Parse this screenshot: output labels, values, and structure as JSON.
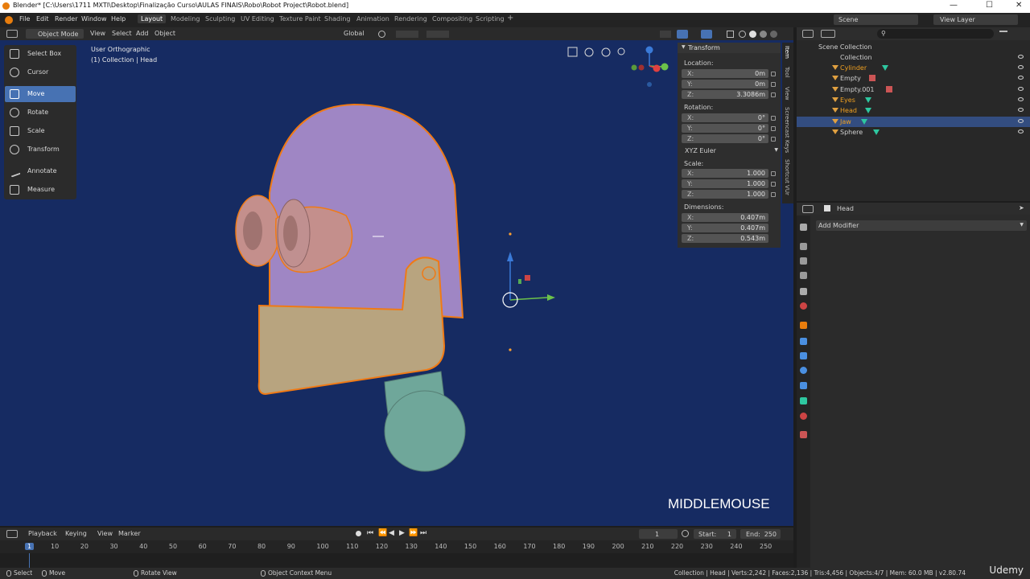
{
  "window": {
    "title": "Blender* [C:\\Users\\1711 MXTI\\Desktop\\Finalização Curso\\AULAS FINAIS\\Robo\\Robot Project\\Robot.blend]",
    "minimize": "—",
    "maximize": "☐",
    "close": "✕"
  },
  "menu": [
    "File",
    "Edit",
    "Render",
    "Window",
    "Help"
  ],
  "workspaces": [
    "Layout",
    "Modeling",
    "Sculpting",
    "UV Editing",
    "Texture Paint",
    "Shading",
    "Animation",
    "Rendering",
    "Compositing",
    "Scripting"
  ],
  "workspace_add": "+",
  "scene": {
    "label": "Scene",
    "view_layer": "View Layer"
  },
  "viewport_header": {
    "mode": "Object Mode",
    "menus": [
      "View",
      "Select",
      "Add",
      "Object"
    ],
    "orientation": "Global"
  },
  "viewport": {
    "view_name": "User Orthographic",
    "collection_info": "(1) Collection | Head",
    "key_overlay": "MIDDLEMOUSE",
    "colors": {
      "background": "#162b62",
      "head": "#9f86c4",
      "eyes": "#c48f8c",
      "jaw": "#b8a47f",
      "neck": "#6fa79a",
      "selection": "#f07a15"
    }
  },
  "tools": [
    "Select Box",
    "Cursor",
    "Move",
    "Rotate",
    "Scale",
    "Transform",
    "Annotate",
    "Measure"
  ],
  "active_tool": "Move",
  "npanel": {
    "tabs": [
      "Item",
      "Tool",
      "View",
      "Screencast Keys",
      "Shortcut VUr"
    ],
    "header": "Transform",
    "location_label": "Location:",
    "location": [
      {
        "k": "X:",
        "v": "0m"
      },
      {
        "k": "Y:",
        "v": "0m"
      },
      {
        "k": "Z:",
        "v": "3.3086m"
      }
    ],
    "rotation_label": "Rotation:",
    "rotation": [
      {
        "k": "X:",
        "v": "0°"
      },
      {
        "k": "Y:",
        "v": "0°"
      },
      {
        "k": "Z:",
        "v": "0°"
      }
    ],
    "rotation_mode": "XYZ Euler",
    "scale_label": "Scale:",
    "scale": [
      {
        "k": "X:",
        "v": "1.000"
      },
      {
        "k": "Y:",
        "v": "1.000"
      },
      {
        "k": "Z:",
        "v": "1.000"
      }
    ],
    "dimensions_label": "Dimensions:",
    "dimensions": [
      {
        "k": "X:",
        "v": "0.407m"
      },
      {
        "k": "Y:",
        "v": "0.407m"
      },
      {
        "k": "Z:",
        "v": "0.543m"
      }
    ]
  },
  "outliner": {
    "scene_collection": "Scene Collection",
    "collection": "Collection",
    "items": [
      {
        "name": "Cylinder",
        "type": "mesh",
        "highlight": true,
        "selected": false
      },
      {
        "name": "Empty",
        "type": "empty",
        "highlight": false,
        "selected": false
      },
      {
        "name": "Empty.001",
        "type": "empty",
        "highlight": false,
        "selected": false
      },
      {
        "name": "Eyes",
        "type": "mesh",
        "highlight": true,
        "selected": false
      },
      {
        "name": "Head",
        "type": "mesh",
        "highlight": true,
        "selected": false
      },
      {
        "name": "Jaw",
        "type": "mesh",
        "highlight": true,
        "selected": true
      },
      {
        "name": "Sphere",
        "type": "mesh",
        "highlight": false,
        "selected": false
      }
    ]
  },
  "properties": {
    "object": "Head",
    "add_modifier": "Add Modifier"
  },
  "timeline": {
    "menus": [
      "Playback",
      "Keying",
      "View",
      "Marker"
    ],
    "current_frame": "1",
    "start_label": "Start:",
    "start": "1",
    "end_label": "End:",
    "end": "250",
    "ticks": [
      "1",
      "10",
      "20",
      "30",
      "40",
      "50",
      "60",
      "70",
      "80",
      "90",
      "100",
      "110",
      "120",
      "130",
      "140",
      "150",
      "160",
      "170",
      "180",
      "190",
      "200",
      "210",
      "220",
      "230",
      "240",
      "250"
    ]
  },
  "statusbar": {
    "select": "Select",
    "move": "Move",
    "rotate_view": "Rotate View",
    "context_menu": "Object Context Menu",
    "stats": "Collection | Head | Verts:2,242 | Faces:2,136 | Tris:4,456 | Objects:4/7 | Mem: 60.0 MB | v2.80.74"
  },
  "watermark": "Udemy"
}
